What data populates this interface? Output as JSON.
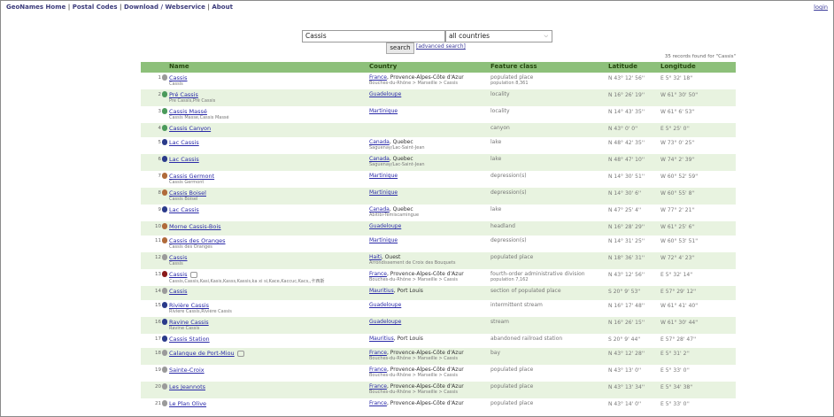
{
  "nav": {
    "links": [
      "GeoNames Home",
      "Postal Codes",
      "Download / Webservice",
      "About"
    ],
    "login": "login"
  },
  "search": {
    "value": "Cassis",
    "country": "all countries",
    "button": "search",
    "advanced": "[advanced search]",
    "records": "35 records found for \"Cassis\""
  },
  "table": {
    "headers": {
      "name": "Name",
      "country": "Country",
      "feature": "Feature class",
      "lat": "Latitude",
      "lon": "Longitude"
    },
    "rows": [
      {
        "num": "1",
        "marker": "gray",
        "name": "Cassis",
        "alt": "Cassis",
        "country": "France",
        "region": ", Provence-Alpes-Côte d'Azur",
        "admin": "Bouches-du-Rhône > Marseille > Cassis",
        "feature": "populated place",
        "feature2": "population 8,361",
        "lat": "N 43° 12' 56''",
        "lon": "E 5° 32' 18''"
      },
      {
        "num": "2",
        "marker": "green",
        "name": "Pré Cassis",
        "alt": "Pre Cassis,Pré Cassis",
        "country": "Guadeloupe",
        "region": "",
        "admin": "",
        "feature": "locality",
        "feature2": "",
        "lat": "N 16° 26' 19''",
        "lon": "W 61° 30' 50''"
      },
      {
        "num": "3",
        "marker": "green",
        "name": "Cassis Massé",
        "alt": "Cassis Masse,Cassis Massé",
        "country": "Martinique",
        "region": "",
        "admin": "",
        "feature": "locality",
        "feature2": "",
        "lat": "N 14° 43' 35''",
        "lon": "W 61° 6' 53''"
      },
      {
        "num": "4",
        "marker": "green",
        "name": "Cassis Canyon",
        "alt": "",
        "country": "",
        "region": "",
        "admin": "",
        "feature": "canyon",
        "feature2": "",
        "lat": "N 43° 0' 0''",
        "lon": "E 5° 25' 0''"
      },
      {
        "num": "5",
        "marker": "blue",
        "name": "Lac Cassis",
        "alt": "",
        "country": "Canada",
        "region": ", Quebec",
        "admin": "Saguenay/Lac-Saint-Jean",
        "feature": "lake",
        "feature2": "",
        "lat": "N 48° 42' 35''",
        "lon": "W 73° 0' 25''"
      },
      {
        "num": "6",
        "marker": "blue",
        "name": "Lac Cassis",
        "alt": "",
        "country": "Canada",
        "region": ", Quebec",
        "admin": "Saguenay/Lac-Saint-Jean",
        "feature": "lake",
        "feature2": "",
        "lat": "N 48° 47' 10''",
        "lon": "W 74° 2' 39''"
      },
      {
        "num": "7",
        "marker": "brown",
        "name": "Cassis Germont",
        "alt": "Cassis Germont",
        "country": "Martinique",
        "region": "",
        "admin": "",
        "feature": "depression(s)",
        "feature2": "",
        "lat": "N 14° 30' 51''",
        "lon": "W 60° 52' 59''"
      },
      {
        "num": "8",
        "marker": "brown",
        "name": "Cassis Boisel",
        "alt": "Cassis Boisel",
        "country": "Martinique",
        "region": "",
        "admin": "",
        "feature": "depression(s)",
        "feature2": "",
        "lat": "N 14° 30' 6''",
        "lon": "W 60° 55' 8''"
      },
      {
        "num": "9",
        "marker": "blue",
        "name": "Lac Cassis",
        "alt": "",
        "country": "Canada",
        "region": ", Quebec",
        "admin": "Abitibi-Témiscamingue",
        "feature": "lake",
        "feature2": "",
        "lat": "N 47° 25' 4''",
        "lon": "W 77° 2' 21''"
      },
      {
        "num": "10",
        "marker": "brown",
        "name": "Morne Cassis-Bois",
        "alt": "",
        "country": "Guadeloupe",
        "region": "",
        "admin": "",
        "feature": "headland",
        "feature2": "",
        "lat": "N 16° 28' 29''",
        "lon": "W 61° 25' 6''"
      },
      {
        "num": "11",
        "marker": "brown",
        "name": "Cassis des Oranges",
        "alt": "Cassis des Oranges",
        "country": "Martinique",
        "region": "",
        "admin": "",
        "feature": "depression(s)",
        "feature2": "",
        "lat": "N 14° 31' 25''",
        "lon": "W 60° 53' 51''"
      },
      {
        "num": "12",
        "marker": "gray",
        "name": "Cassis",
        "alt": "Cassis",
        "country": "Haiti",
        "region": ", Ouest",
        "admin": "Arrondissement de Croix des Bouquets",
        "feature": "populated place",
        "feature2": "",
        "lat": "N 18° 36' 31''",
        "lon": "W 72° 4' 23''"
      },
      {
        "num": "13",
        "marker": "darkred",
        "name": "Cassis",
        "alt": "Cassis,Cassis,Kasi,Kasis,Kasss,Kassis,ka xi si,Kace,Kaccuc,Kacs,,卡西斯",
        "country": "France",
        "region": ", Provence-Alpes-Côte d'Azur",
        "admin": "Bouches-du-Rhône > Marseille > Cassis",
        "feature": "fourth-order administrative division",
        "feature2": "population 7,162",
        "lat": "N 43° 12' 56''",
        "lon": "E 5° 32' 14''"
      },
      {
        "num": "14",
        "marker": "gray",
        "name": "Cassis",
        "alt": "",
        "country": "Mauritius",
        "region": ", Port Louis",
        "admin": "",
        "feature": "section of populated place",
        "feature2": "",
        "lat": "S 20° 9' 53''",
        "lon": "E 57° 29' 12''"
      },
      {
        "num": "15",
        "marker": "blue",
        "name": "Rivière Cassis",
        "alt": "Riviere Cassis,Rivière Cassis",
        "country": "Guadeloupe",
        "region": "",
        "admin": "",
        "feature": "intermittent stream",
        "feature2": "",
        "lat": "N 16° 17' 48''",
        "lon": "W 61° 41' 40''"
      },
      {
        "num": "16",
        "marker": "blue",
        "name": "Ravine Cassis",
        "alt": "Ravine Cassis",
        "country": "Guadeloupe",
        "region": "",
        "admin": "",
        "feature": "stream",
        "feature2": "",
        "lat": "N 16° 26' 15''",
        "lon": "W 61° 30' 44''"
      },
      {
        "num": "17",
        "marker": "blue",
        "name": "Cassis Station",
        "alt": "",
        "country": "Mauritius",
        "region": ", Port Louis",
        "admin": "",
        "feature": "abandoned railroad station",
        "feature2": "",
        "lat": "S 20° 9' 44''",
        "lon": "E 57° 28' 47''"
      },
      {
        "num": "18",
        "marker": "gray",
        "name": "Calanque de Port-Miou",
        "alt": "",
        "country": "France",
        "region": ", Provence-Alpes-Côte d'Azur",
        "admin": "Bouches-du-Rhône > Marseille > Cassis",
        "feature": "bay",
        "feature2": "",
        "lat": "N 43° 12' 28''",
        "lon": "E 5° 31' 2''"
      },
      {
        "num": "19",
        "marker": "gray",
        "name": "Sainte-Croix",
        "alt": "",
        "country": "France",
        "region": ", Provence-Alpes-Côte d'Azur",
        "admin": "Bouches-du-Rhône > Marseille > Cassis",
        "feature": "populated place",
        "feature2": "",
        "lat": "N 43° 13' 0''",
        "lon": "E 5° 33' 0''"
      },
      {
        "num": "20",
        "marker": "gray",
        "name": "Les Jeannots",
        "alt": "",
        "country": "France",
        "region": ", Provence-Alpes-Côte d'Azur",
        "admin": "Bouches-du-Rhône > Marseille > Cassis",
        "feature": "populated place",
        "feature2": "",
        "lat": "N 43° 13' 34''",
        "lon": "E 5° 34' 38''"
      },
      {
        "num": "21",
        "marker": "gray",
        "name": "Le Plan Olive",
        "alt": "",
        "country": "France",
        "region": ", Provence-Alpes-Côte d'Azur",
        "admin": "",
        "feature": "populated place",
        "feature2": "",
        "lat": "N 43° 14' 0''",
        "lon": "E 5° 33' 0''"
      }
    ]
  }
}
